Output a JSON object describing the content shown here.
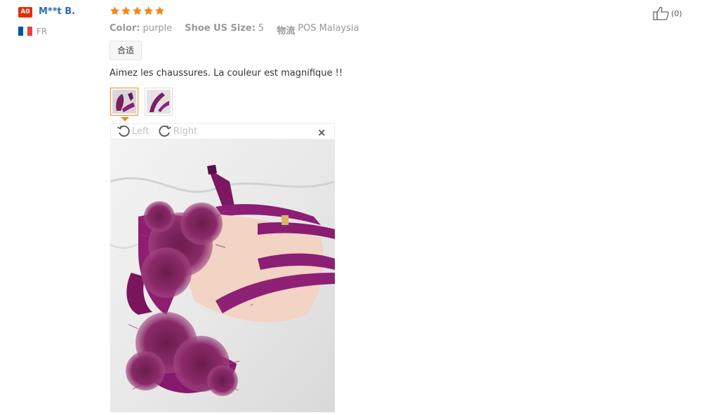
{
  "user": {
    "level_badge": "A0",
    "name": "M**t B.",
    "country": "FR",
    "flag_colors": [
      "#0055a4",
      "#ffffff",
      "#ef4135"
    ]
  },
  "review": {
    "rating": 5,
    "star_color": "#f7861f",
    "attributes": [
      {
        "label": "Color:",
        "value": "purple"
      },
      {
        "label": "Shoe US Size:",
        "value": "5"
      },
      {
        "label": "物流",
        "value": "POS Malaysia"
      }
    ],
    "tag": "合适",
    "text": "Aimez les chaussures. La couleur est magnifique !!",
    "thumbnail_count": 2,
    "active_thumbnail": 0
  },
  "viewer": {
    "rotate_left_label": "Left",
    "rotate_right_label": "Right",
    "close_label": "×"
  },
  "like": {
    "count_label": "(0)"
  }
}
